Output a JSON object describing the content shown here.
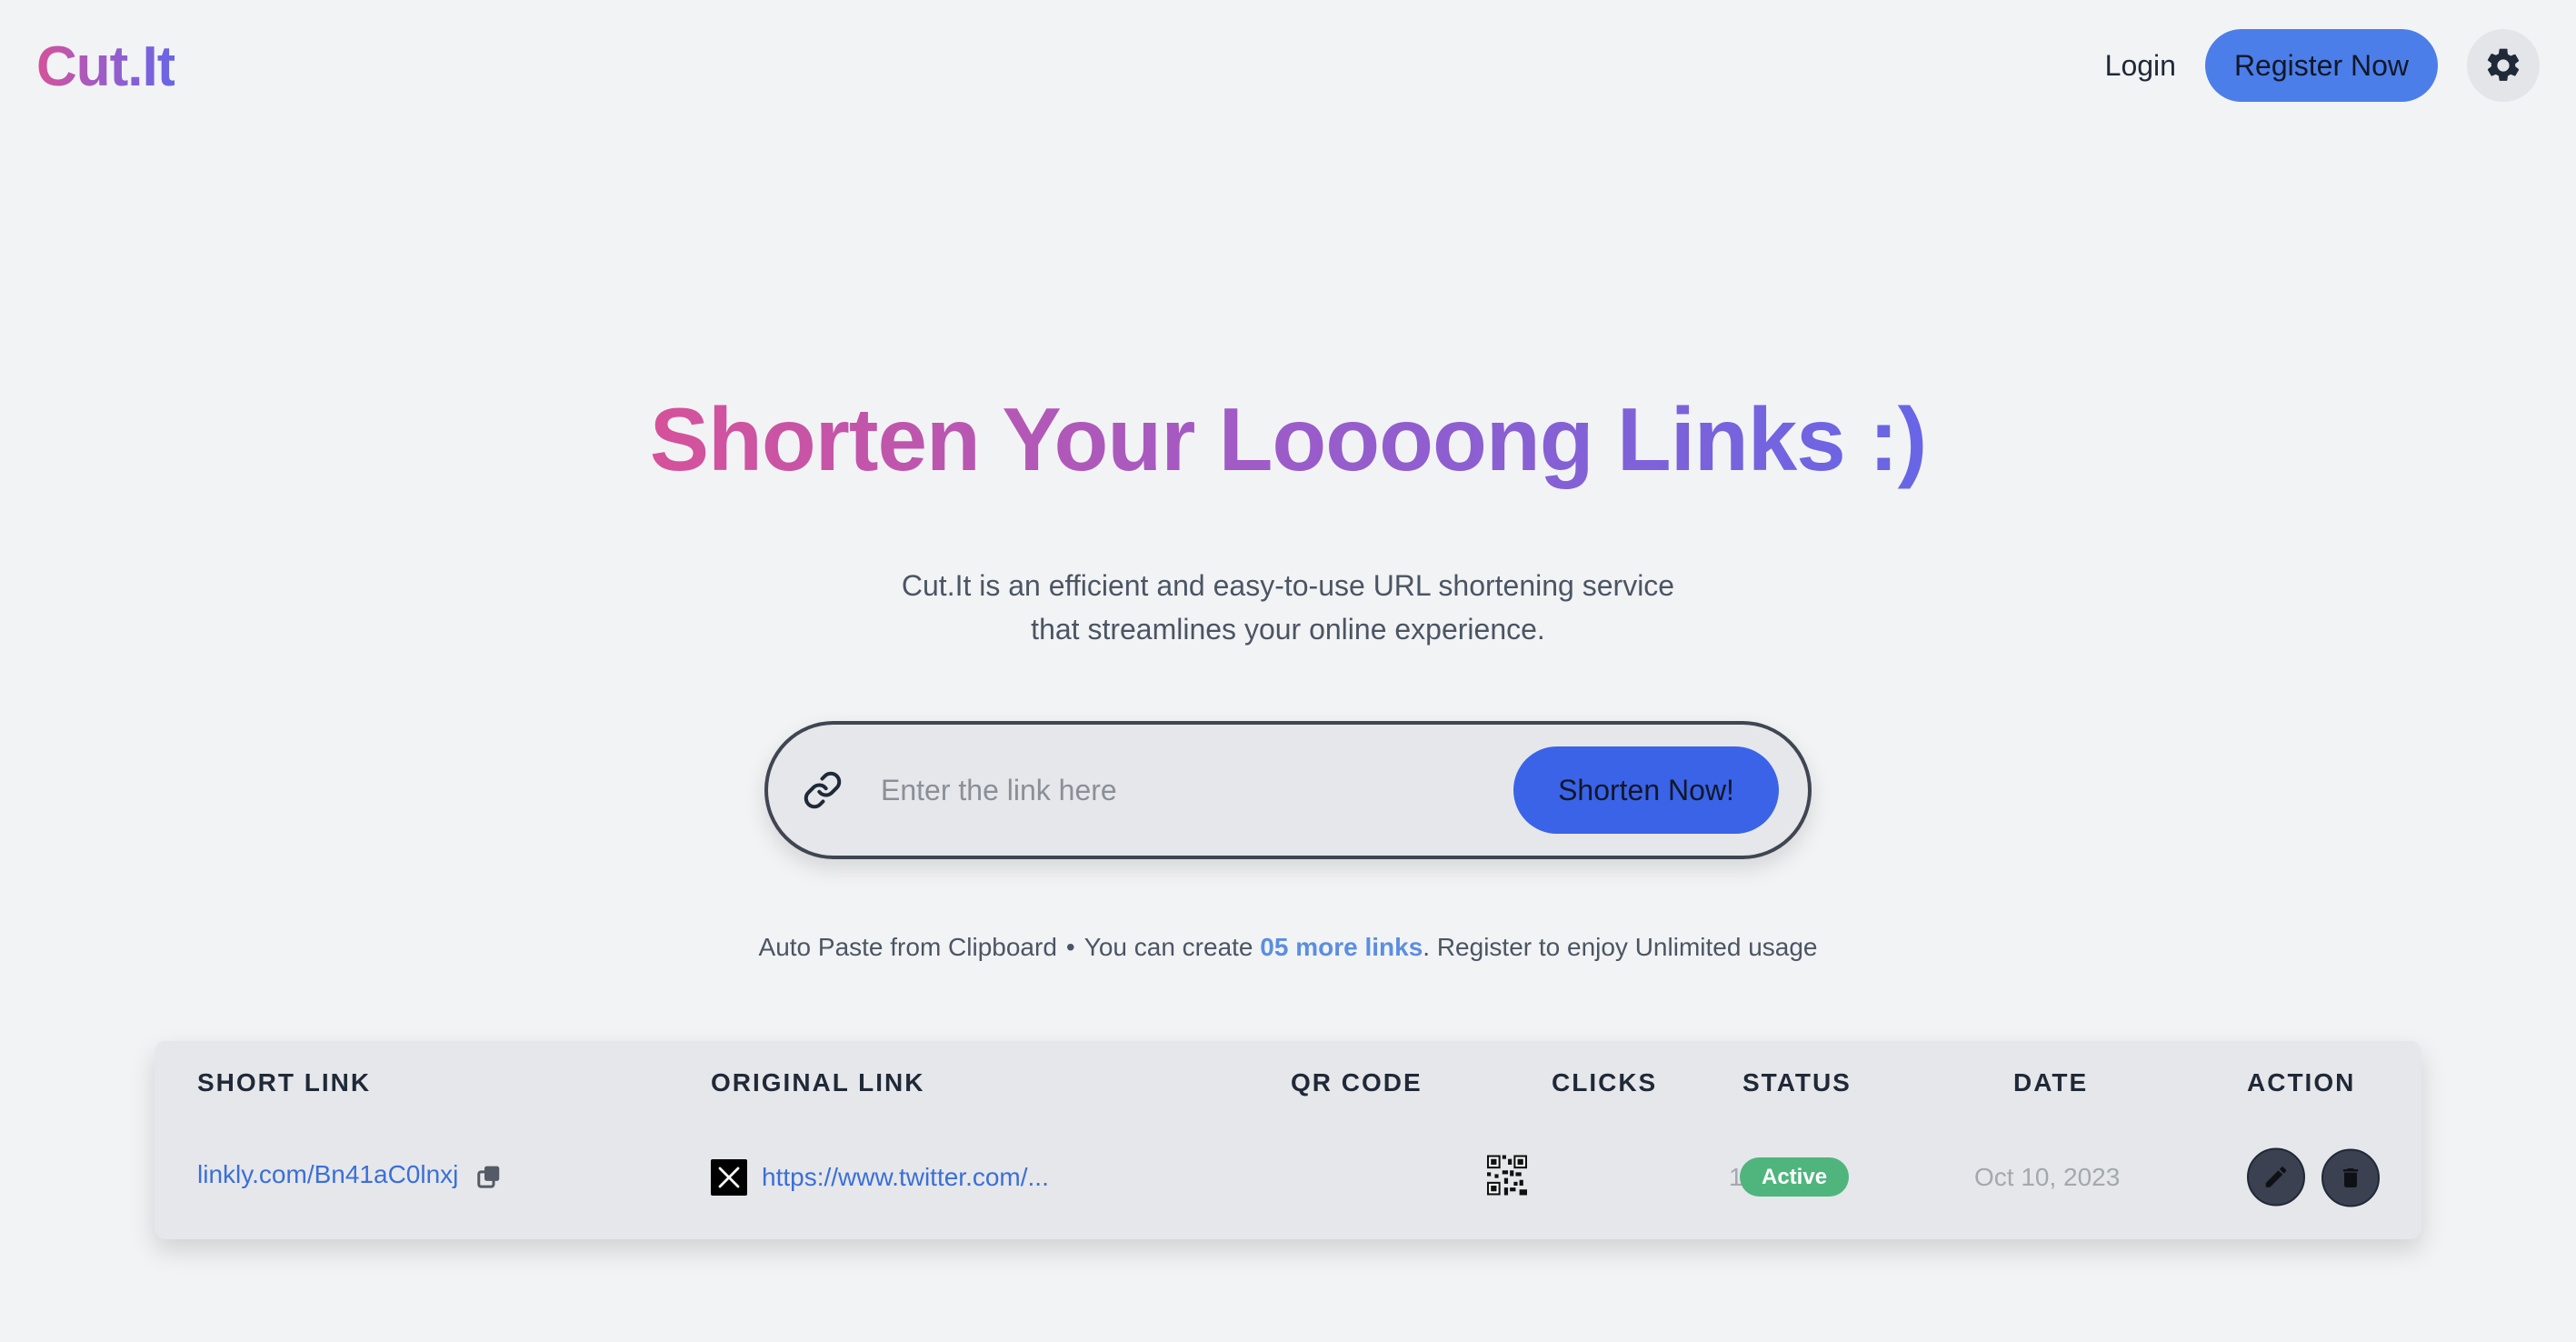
{
  "brand": {
    "name": "Cut.It"
  },
  "nav": {
    "login": "Login",
    "register": "Register Now",
    "theme_icon": "gear-icon"
  },
  "hero": {
    "title_parts": [
      "Shorten Your",
      "Loooong",
      "Links :)"
    ],
    "subtitle_line1": "Cut.It is an efficient and easy-to-use URL shortening service",
    "subtitle_line2": "that streamlines your online experience."
  },
  "shorten": {
    "placeholder": "Enter the link here",
    "button": "Shorten Now!",
    "icon": "link-icon"
  },
  "info": {
    "auto_paste": "Auto Paste from Clipboard",
    "separator": "•",
    "prefix": "You can create",
    "highlight": "05 more links",
    "suffix": ". Register to enjoy Unlimited usage"
  },
  "table": {
    "headers": [
      "SHORT LINK",
      "ORIGINAL LINK",
      "QR CODE",
      "CLICKS",
      "STATUS",
      "DATE",
      "ACTION"
    ],
    "rows": [
      {
        "short_link": "linkly.com/Bn41aC0lnxj",
        "original_link": "https://www.twitter.com/...",
        "favicon": "x-logo-icon",
        "qr": "qr-code-icon",
        "clicks": "1313",
        "status": "Active",
        "date": "Oct 10, 2023"
      }
    ]
  },
  "colors": {
    "gradient_start": "#d6529a",
    "gradient_end": "#6766e6",
    "primary": "#3a63e8",
    "status_active": "#4fb57d",
    "link": "#3a6fd8"
  }
}
